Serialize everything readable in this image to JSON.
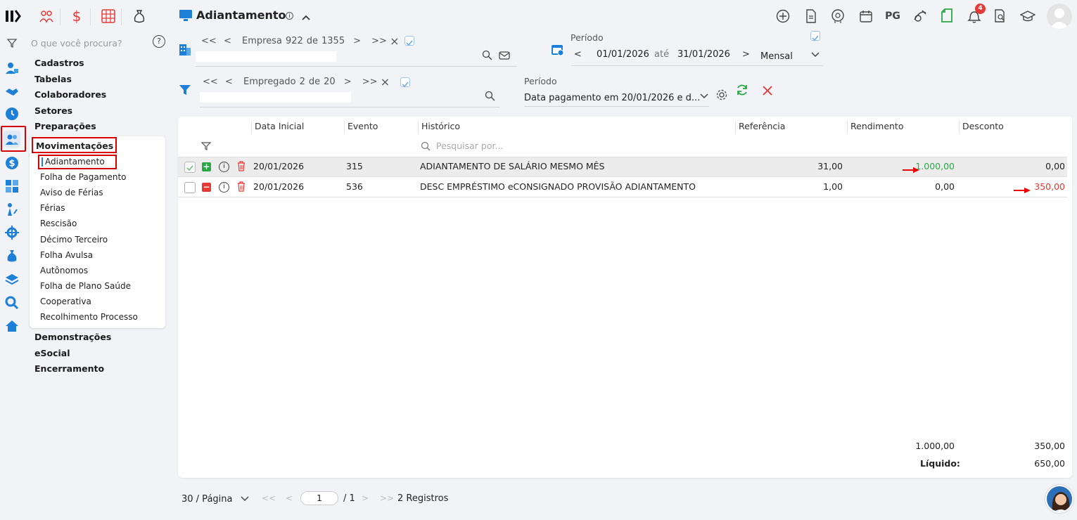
{
  "sidebar_search": {
    "placeholder": "O que você procura?"
  },
  "menu": {
    "top": [
      "Cadastros",
      "Tabelas",
      "Colaboradores",
      "Setores",
      "Preparações"
    ],
    "active_group": "Movimentações",
    "active_item": "Adiantamento",
    "sub_items": [
      "Folha de Pagamento",
      "Aviso de Férias",
      "Férias",
      "Rescisão",
      "Décimo Terceiro",
      "Folha Avulsa",
      "Autônomos",
      "Folha de Plano Saúde",
      "Cooperativa",
      "Recolhimento Processo"
    ],
    "bottom": [
      "Demonstrações",
      "eSocial",
      "Encerramento"
    ]
  },
  "header": {
    "title": "Adiantamento",
    "pg_label": "PG",
    "notifications_count": "4"
  },
  "empresa_nav": {
    "first": "<<",
    "prev": "<",
    "label": "Empresa",
    "current": "922",
    "of": "de",
    "total": "1355",
    "next": ">",
    "last": ">>",
    "close": "×"
  },
  "empregado_nav": {
    "first": "<<",
    "prev": "<",
    "label": "Empregado",
    "current": "2",
    "of": "de",
    "total": "20",
    "next": ">",
    "last": ">>",
    "close": "×"
  },
  "periodo": {
    "label": "Período",
    "start": "01/01/2026",
    "sep": "até",
    "end": "31/01/2026",
    "mode": "Mensal",
    "prev": "<",
    "next": ">"
  },
  "periodo2": {
    "label": "Período",
    "value": "Data pagamento em 20/01/2026 e d..."
  },
  "table": {
    "headers": [
      "Data Inicial",
      "Evento",
      "Histórico",
      "Referência",
      "Rendimento",
      "Desconto"
    ],
    "search_placeholder": "Pesquisar por...",
    "rows": [
      {
        "data": "20/01/2026",
        "evento": "315",
        "historico": "ADIANTAMENTO DE SALÁRIO MESMO MÊS",
        "referencia": "31,00",
        "rendimento": "1.000,00",
        "desconto": "0,00",
        "checked": true,
        "sign": "+"
      },
      {
        "data": "20/01/2026",
        "evento": "536",
        "historico": "DESC EMPRÉSTIMO eCONSIGNADO PROVISÃO ADIANTAMENTO",
        "referencia": "1,00",
        "rendimento": "0,00",
        "desconto": "350,00",
        "checked": false,
        "sign": "−"
      }
    ],
    "total_rendimento": "1.000,00",
    "total_desconto": "350,00",
    "liquido_label": "Líquido:",
    "liquido_value": "650,00"
  },
  "pagination": {
    "per_page": "30 / Página",
    "page": "1",
    "total_pages": "/ 1",
    "records": "2 Registros",
    "first": "<<",
    "prev": "<",
    "next": ">",
    "last": ">>"
  },
  "colors": {
    "accent": "#1e7fd8",
    "positive": "#27a844",
    "negative": "#e53935",
    "highlight_border": "#d60000"
  }
}
